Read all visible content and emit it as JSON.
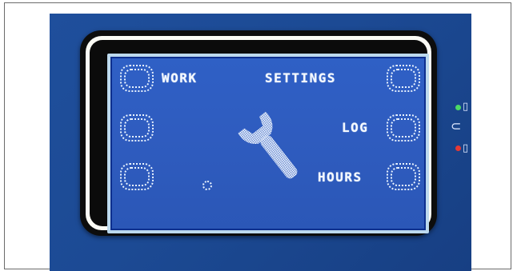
{
  "panel": {
    "buttons": {
      "left_top": "WORK",
      "right_top": "SETTINGS",
      "right_middle": "LOG",
      "right_bottom": "HOURS"
    },
    "center_icon": "wrench-icon",
    "colors": {
      "device_blue": "#1c4a94",
      "lcd_blue": "#2a5cc4",
      "lcd_text": "#f4f9ff",
      "led_green": "#4cd964",
      "led_red": "#e53935"
    }
  }
}
